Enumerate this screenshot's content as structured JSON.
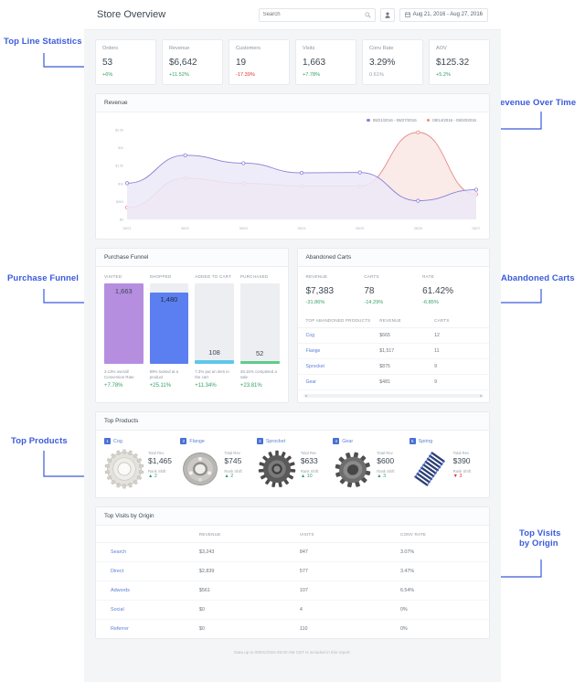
{
  "annotations": [
    {
      "id": "top-line-statistics",
      "label": "Top Line Statistics"
    },
    {
      "id": "revenue-over-time",
      "label": "Revenue Over Time"
    },
    {
      "id": "purchase-funnel",
      "label": "Purchase Funnel"
    },
    {
      "id": "abandoned-carts",
      "label": "Abandoned Carts"
    },
    {
      "id": "top-products",
      "label": "Top Products"
    },
    {
      "id": "top-visits-by-origin-1",
      "label": "Top Visits"
    },
    {
      "id": "top-visits-by-origin-2",
      "label": "by Origin"
    }
  ],
  "header": {
    "title": "Store Overview",
    "search_placeholder": "Search",
    "search_value": "",
    "search_icon": "search-icon",
    "user_icon": "user-icon",
    "calendar_icon": "calendar-icon",
    "date_range": "Aug 21, 2016 - Aug 27, 2016"
  },
  "stats": [
    {
      "label": "Orders",
      "value": "53",
      "delta": "+6%",
      "tone": "pos"
    },
    {
      "label": "Revenue",
      "value": "$6,642",
      "delta": "+11.52%",
      "tone": "pos"
    },
    {
      "label": "Customers",
      "value": "19",
      "delta": "-17.39%",
      "tone": "neg"
    },
    {
      "label": "Visits",
      "value": "1,663",
      "delta": "+7.78%",
      "tone": "pos"
    },
    {
      "label": "Conv Rate",
      "value": "3.29%",
      "delta": "0.61%",
      "tone": "neu"
    },
    {
      "label": "AOV",
      "value": "$125.32",
      "delta": "+5.2%",
      "tone": "pos"
    }
  ],
  "revenue_panel": {
    "title": "Revenue"
  },
  "chart_data": {
    "type": "area",
    "title": "Revenue",
    "xlabel": "",
    "ylabel": "",
    "ylim": [
      0,
      2500
    ],
    "yticks": [
      "$2.5k",
      "$2k",
      "$1.5k",
      "$1k",
      "$500",
      "$0"
    ],
    "ytick_values": [
      2500,
      2000,
      1500,
      1000,
      500,
      0
    ],
    "categories": [
      "08/21",
      "08/22",
      "08/23",
      "08/24",
      "08/25",
      "08/26",
      "08/27"
    ],
    "grid": false,
    "legend_position": "top-right",
    "series": [
      {
        "name": "08/21/2016 - 08/27/2016",
        "color": "#8b7fd4",
        "fill": "#ece9f8",
        "values": [
          1010,
          1790,
          1570,
          1300,
          1310,
          520,
          830
        ]
      },
      {
        "name": "08/14/2016 - 08/20/2016",
        "color": "#e88a8a",
        "fill": "#f9e6e4",
        "values": [
          330,
          1150,
          1010,
          930,
          930,
          2430,
          700
        ]
      }
    ]
  },
  "funnel": {
    "title": "Purchase Funnel",
    "steps": [
      {
        "label": "VISITED",
        "value": "1,663",
        "fill_pct": 100,
        "color": "#b68ee0",
        "desc": "3.13% overall Conversion Rate",
        "delta": "+7.78%"
      },
      {
        "label": "SHOPPED",
        "value": "1,480",
        "fill_pct": 89,
        "color": "#5b7ff0",
        "desc": "89% looked at a product",
        "delta": "+25.11%"
      },
      {
        "label": "ADDED TO CART",
        "value": "108",
        "fill_pct": 8,
        "color": "#5ec8e8",
        "desc": "7.3% put an item in the cart",
        "delta": "+11.34%"
      },
      {
        "label": "PURCHASED",
        "value": "52",
        "fill_pct": 4,
        "color": "#5fcb8a",
        "desc": "48.15% completed a sale",
        "delta": "+23.81%"
      }
    ]
  },
  "abandoned_carts": {
    "title": "Abandoned Carts",
    "metrics": [
      {
        "label": "REVENUE",
        "value": "$7,383",
        "delta": "-31.86%"
      },
      {
        "label": "CARTS",
        "value": "78",
        "delta": "-14.29%"
      },
      {
        "label": "RATE",
        "value": "61.42%",
        "delta": "-6.85%"
      }
    ],
    "table": {
      "columns": [
        "TOP ABANDONED PRODUCTS",
        "REVENUE",
        "CARTS"
      ],
      "rows": [
        [
          "Cog",
          "$665",
          "12"
        ],
        [
          "Flange",
          "$1,517",
          "11"
        ],
        [
          "Sprocket",
          "$875",
          "9"
        ],
        [
          "Gear",
          "$481",
          "9"
        ]
      ]
    }
  },
  "top_products": {
    "title": "Top Products",
    "rev_label": "Total Rev",
    "shift_label": "Rank Shift",
    "items": [
      {
        "rank": "1",
        "name": "Cog",
        "revenue": "$1,465",
        "shift": "2",
        "dir": "up",
        "icon": "gear-ring-icon"
      },
      {
        "rank": "2",
        "name": "Flange",
        "revenue": "$745",
        "shift": "2",
        "dir": "up",
        "icon": "flange-disc-icon"
      },
      {
        "rank": "3",
        "name": "Sprocket",
        "revenue": "$633",
        "shift": "10",
        "dir": "up",
        "icon": "sprocket-icon"
      },
      {
        "rank": "4",
        "name": "Gear",
        "revenue": "$600",
        "shift": "3",
        "dir": "up",
        "icon": "gear-icon"
      },
      {
        "rank": "5",
        "name": "Spring",
        "revenue": "$390",
        "shift": "3",
        "dir": "down",
        "icon": "spring-coil-icon"
      }
    ]
  },
  "origin": {
    "title": "Top Visits by Origin",
    "columns": [
      "",
      "REVENUE",
      "VISITS",
      "CONV RATE"
    ],
    "rows": [
      [
        "Search",
        "$3,243",
        "847",
        "3.07%"
      ],
      [
        "Direct",
        "$2,839",
        "577",
        "3.47%"
      ],
      [
        "Adwords",
        "$561",
        "107",
        "6.54%"
      ],
      [
        "Social",
        "$0",
        "4",
        "0%"
      ],
      [
        "Referrer",
        "$0",
        "110",
        "0%"
      ]
    ]
  },
  "footer": {
    "note": "Data up to 09/01/2016 05:00 AM CDT is included in this report."
  }
}
